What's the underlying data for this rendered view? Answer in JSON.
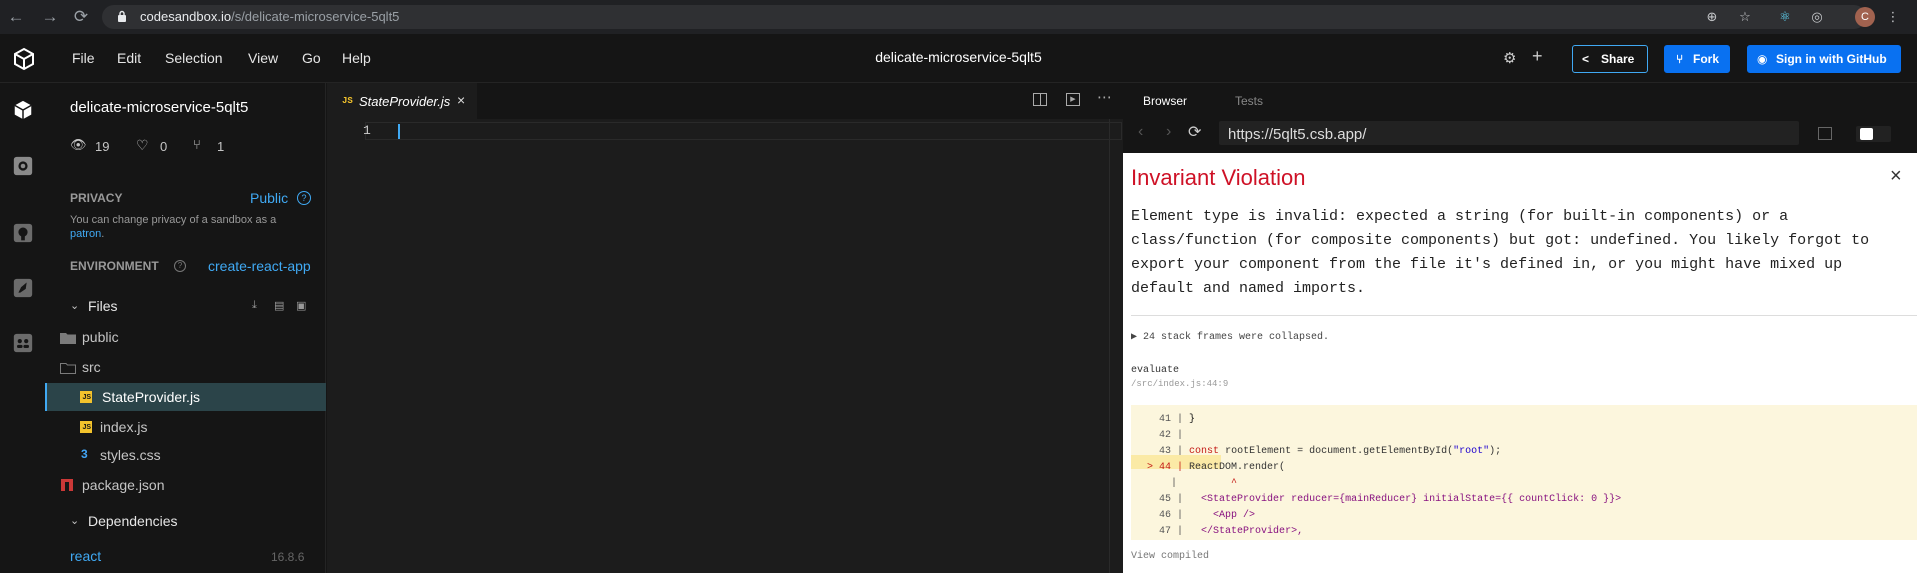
{
  "browser": {
    "url_host": "codesandbox.io",
    "url_path": "/s/delicate-microservice-5qlt5",
    "profile_initial": "C"
  },
  "menu": [
    "File",
    "Edit",
    "Selection",
    "View",
    "Go",
    "Help"
  ],
  "header": {
    "title": "delicate-microservice-5qlt5",
    "share_label": "Share",
    "fork_label": "Fork",
    "signin_label": "Sign in with GitHub"
  },
  "sidebar": {
    "project_name": "delicate-microservice-5qlt5",
    "views": "19",
    "likes": "0",
    "forks": "1",
    "privacy_label": "PRIVACY",
    "privacy_value": "Public",
    "privacy_note": "You can change privacy of a sandbox as a",
    "privacy_link": "patron",
    "privacy_note_end": ".",
    "environment_label": "ENVIRONMENT",
    "environment_value": "create-react-app",
    "files_label": "Files",
    "files": [
      {
        "name": "public",
        "type": "folder"
      },
      {
        "name": "src",
        "type": "folder-open"
      },
      {
        "name": "StateProvider.js",
        "type": "js",
        "active": true
      },
      {
        "name": "index.js",
        "type": "js"
      },
      {
        "name": "styles.css",
        "type": "css"
      },
      {
        "name": "package.json",
        "type": "npm"
      }
    ],
    "dependencies_label": "Dependencies",
    "dependency_name": "react",
    "dependency_version": "16.8.6"
  },
  "editor": {
    "tab_badge": "JS",
    "tab_name": "StateProvider.js",
    "line_number": "1"
  },
  "preview": {
    "tab_browser": "Browser",
    "tab_tests": "Tests",
    "address": "https://5qlt5.csb.app/",
    "error_title": "Invariant Violation",
    "error_lines": [
      "Element type is invalid: expected a string (for built-in components) or a",
      "class/function (for composite components) but got: undefined. You likely forgot to",
      "export your component from the file it's defined in, or you might have mixed up",
      "default and named imports."
    ],
    "collapsed": "▶ 24 stack frames were collapsed.",
    "frame_name": "evaluate",
    "frame_location": "/src/index.js:44:9",
    "code_lines": [
      {
        "num": "41",
        "code": "}"
      },
      {
        "num": "42",
        "code": ""
      },
      {
        "num": "43",
        "code": "const rootElement = document.getElementById(\"root\");"
      },
      {
        "num": "44",
        "code": "ReactDOM.render(",
        "highlight": true
      },
      {
        "num": "",
        "code": "        ^"
      },
      {
        "num": "45",
        "code": "  <StateProvider reducer={mainReducer} initialState={{ countClick: 0 }}>"
      },
      {
        "num": "46",
        "code": "    <App />"
      },
      {
        "num": "47",
        "code": "  </StateProvider>,"
      }
    ],
    "view_compiled": "View compiled"
  },
  "colors": {
    "accent": "#0971f1",
    "link": "#40a9f3",
    "error_red": "#ce1126",
    "active_row": "#2b4449"
  }
}
